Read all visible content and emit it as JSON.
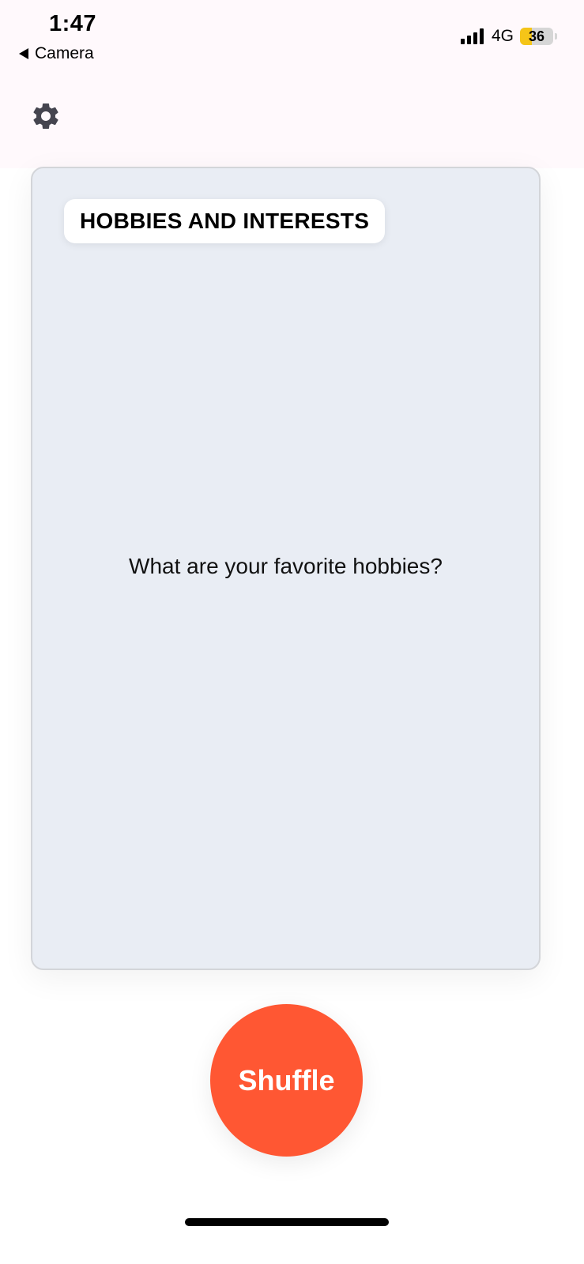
{
  "status_bar": {
    "time": "1:47",
    "back_label": "Camera",
    "network": "4G",
    "battery_level": "36",
    "battery_fraction": 0.36
  },
  "toolbar": {
    "settings_icon": "gear-icon"
  },
  "card": {
    "category": "HOBBIES AND INTERESTS",
    "question": "What are your favorite hobbies?"
  },
  "actions": {
    "shuffle_label": "Shuffle"
  },
  "colors": {
    "accent": "#ff5733",
    "card_background": "#e9edf4",
    "header_background": "#fff9fc",
    "battery": "#f5c518"
  }
}
